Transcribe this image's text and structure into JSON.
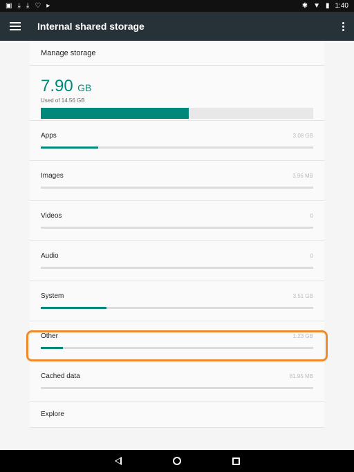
{
  "status_bar": {
    "time": "1:40",
    "icons": [
      "image-icon",
      "download-icon",
      "download-icon",
      "heart-icon",
      "play-icon"
    ],
    "right_icons": [
      "bluetooth-icon",
      "wifi-icon",
      "battery-icon"
    ]
  },
  "app_bar": {
    "title": "Internal shared storage",
    "menu_icon": "hamburger-icon",
    "overflow_icon": "more-vert-icon"
  },
  "manage_storage": "Manage storage",
  "summary": {
    "used_value": "7.90",
    "used_unit": "GB",
    "used_of": "Used of 14.56 GB",
    "fill_fraction": 0.543
  },
  "categories": [
    {
      "label": "Apps",
      "size": "3.08 GB",
      "fraction": 0.21
    },
    {
      "label": "Images",
      "size": "3.96 MB",
      "fraction": 0.0
    },
    {
      "label": "Videos",
      "size": "0",
      "fraction": 0.0
    },
    {
      "label": "Audio",
      "size": "0",
      "fraction": 0.0
    },
    {
      "label": "System",
      "size": "3.51 GB",
      "fraction": 0.24
    },
    {
      "label": "Other",
      "size": "1.23 GB",
      "fraction": 0.08
    },
    {
      "label": "Cached data",
      "size": "81.95 MB",
      "fraction": 0.0
    }
  ],
  "explore": "Explore",
  "colors": {
    "accent": "#00897b",
    "app_bar": "#263238",
    "highlight": "#f0892a"
  }
}
